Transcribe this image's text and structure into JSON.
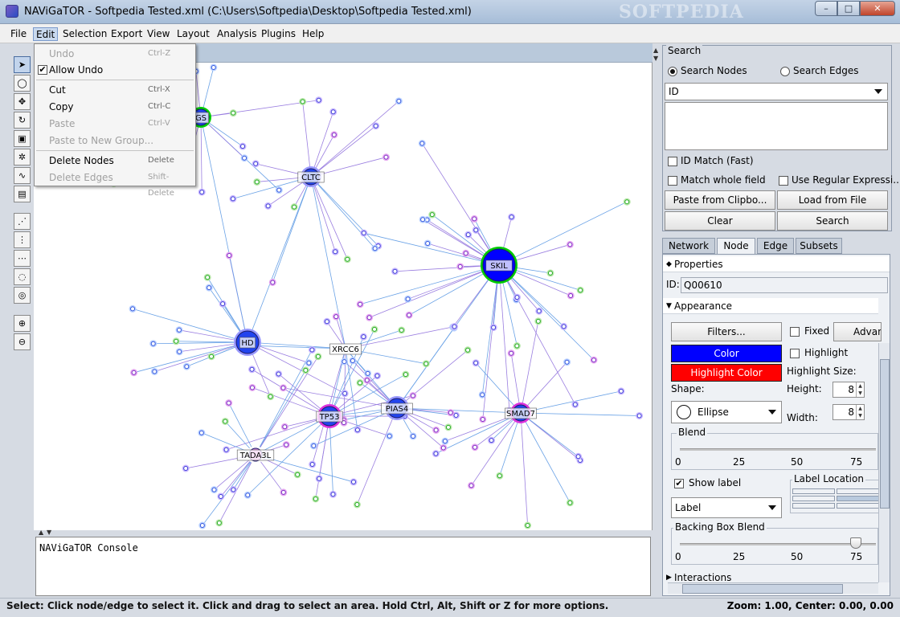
{
  "window": {
    "title": "NAViGaTOR - Softpedia Tested.xml (C:\\Users\\Softpedia\\Desktop\\Softpedia Tested.xml)",
    "watermark": "SOFTPEDIA",
    "minimize": "–",
    "maximize": "□",
    "close": "✕"
  },
  "menubar": {
    "items": [
      "File",
      "Edit",
      "Selection",
      "Export",
      "View",
      "Layout",
      "Analysis",
      "Plugins",
      "Help"
    ]
  },
  "edit_menu": {
    "undo": {
      "label": "Undo",
      "shortcut": "Ctrl-Z"
    },
    "allow_undo": {
      "label": "Allow Undo",
      "checked": "✔"
    },
    "cut": {
      "label": "Cut",
      "shortcut": "Ctrl-X"
    },
    "copy": {
      "label": "Copy",
      "shortcut": "Ctrl-C"
    },
    "paste": {
      "label": "Paste",
      "shortcut": "Ctrl-V"
    },
    "paste_group": {
      "label": "Paste to New Group..."
    },
    "delete_nodes": {
      "label": "Delete Nodes",
      "shortcut": "Delete"
    },
    "delete_edges": {
      "label": "Delete Edges",
      "shortcut": "Shift-Delete"
    }
  },
  "graph": {
    "hubs": [
      {
        "label": "SKIL",
        "fill": "#0000ff",
        "ring": "#00cc00"
      },
      {
        "label": "HD",
        "fill": "#2244ee",
        "ring": "#9999ff"
      },
      {
        "label": "CLTC",
        "fill": "#2244ee",
        "ring": "#9999ff"
      },
      {
        "label": "TP53",
        "fill": "#2244ee",
        "ring": "#dd33dd"
      },
      {
        "label": "PIAS4",
        "fill": "#2244ee",
        "ring": "#9999ff"
      },
      {
        "label": "SMAD7",
        "fill": "#2244ee",
        "ring": "#dd33dd"
      },
      {
        "label": "XRCC6",
        "fill": "#ffffff",
        "ring": "#ffffff"
      },
      {
        "label": "TADA3L",
        "fill": "#dd88dd",
        "ring": "#ffffff"
      },
      {
        "label": "GS",
        "fill": "#2244ee",
        "ring": "#00cc00"
      }
    ],
    "edge_color": "#6aa2e6",
    "edge_color_alt": "#9a7ee0"
  },
  "console": {
    "text": "NAViGaTOR Console"
  },
  "status": {
    "left": "Select: Click node/edge to select it. Click and drag to select an area. Hold Ctrl, Alt, Shift or Z for more options.",
    "right": "Zoom: 1.00, Center: 0.00, 0.00"
  },
  "search": {
    "title": "Search",
    "search_nodes": "Search Nodes",
    "search_edges": "Search Edges",
    "field_select": "ID",
    "id_match": "ID Match (Fast)",
    "match_whole": "Match whole field",
    "use_regex": "Use Regular Expressi...",
    "paste_clipboard": "Paste from Clipbo...",
    "load_file": "Load from File",
    "clear": "Clear",
    "search_btn": "Search"
  },
  "tabs": [
    "Network",
    "Node",
    "Edge",
    "Subsets"
  ],
  "node_panel": {
    "properties": "Properties",
    "id_label": "ID:",
    "id_value": "Q00610",
    "appearance": "Appearance",
    "filters": "Filters...",
    "fixed": "Fixed",
    "advanced": "Advan",
    "color": "Color",
    "color_value": "#0000ff",
    "highlight": "Highlight",
    "highlight_color": "Highlight Color",
    "highlight_color_value": "#ff0000",
    "highlight_size": "Highlight Size:",
    "shape_label": "Shape:",
    "shape_value": "Ellipse",
    "height_label": "Height:",
    "height_value": "8",
    "width_label": "Width:",
    "width_value": "8",
    "blend": "Blend",
    "blend_ticks": [
      "0",
      "25",
      "50",
      "75"
    ],
    "show_label": "Show label",
    "label_location": "Label Location",
    "label_select": "Label",
    "backing_box_blend": "Backing Box Blend",
    "backing_ticks": [
      "0",
      "25",
      "50",
      "75"
    ],
    "interactions": "Interactions"
  }
}
